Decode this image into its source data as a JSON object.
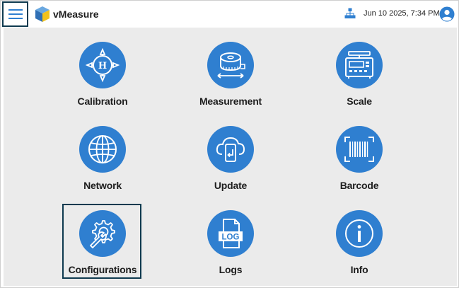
{
  "app": {
    "title": "vMeasure",
    "datetime": "Jun 10 2025, 7:34 PM"
  },
  "header": {
    "menu_icon": "hamburger-menu-icon",
    "logo_icon": "cube-logo-icon",
    "network_icon": "network-tree-icon",
    "avatar_icon": "user-avatar-icon"
  },
  "colors": {
    "accent": "#2f7fd0",
    "panel_bg": "#ebebeb",
    "focus_border": "#0f3a4f"
  },
  "tiles": [
    {
      "label": "Calibration",
      "icon": "calibration-target-icon"
    },
    {
      "label": "Measurement",
      "icon": "tape-measure-icon"
    },
    {
      "label": "Scale",
      "icon": "weighing-scale-icon"
    },
    {
      "label": "Network",
      "icon": "globe-icon"
    },
    {
      "label": "Update",
      "icon": "cloud-device-update-icon"
    },
    {
      "label": "Barcode",
      "icon": "barcode-icon"
    },
    {
      "label": "Configurations",
      "icon": "gear-wrench-icon"
    },
    {
      "label": "Logs",
      "icon": "log-file-icon"
    },
    {
      "label": "Info",
      "icon": "info-icon"
    }
  ],
  "selected_tile": "Configurations"
}
